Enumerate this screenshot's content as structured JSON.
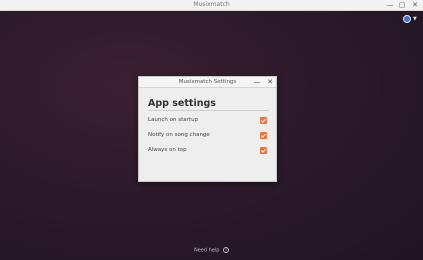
{
  "window": {
    "title": "Musixmatch",
    "minimize_glyph": "—",
    "maximize_glyph": "▢",
    "close_glyph": "✕"
  },
  "dialog": {
    "title": "Musixmatch Settings",
    "minimize_glyph": "—",
    "close_glyph": "✕",
    "heading": "App settings",
    "options": [
      {
        "label": "Launch on startup",
        "checked": true
      },
      {
        "label": "Notify on song change",
        "checked": true
      },
      {
        "label": "Always on top",
        "checked": true
      }
    ]
  },
  "footer": {
    "help_label": "Need help",
    "help_glyph": "?"
  },
  "colors": {
    "accent": "#e9733f",
    "background": "#2c1a2a"
  },
  "icons": {
    "account": "account-icon",
    "dropdown": "chevron-down-icon",
    "help": "help-circle-icon"
  }
}
